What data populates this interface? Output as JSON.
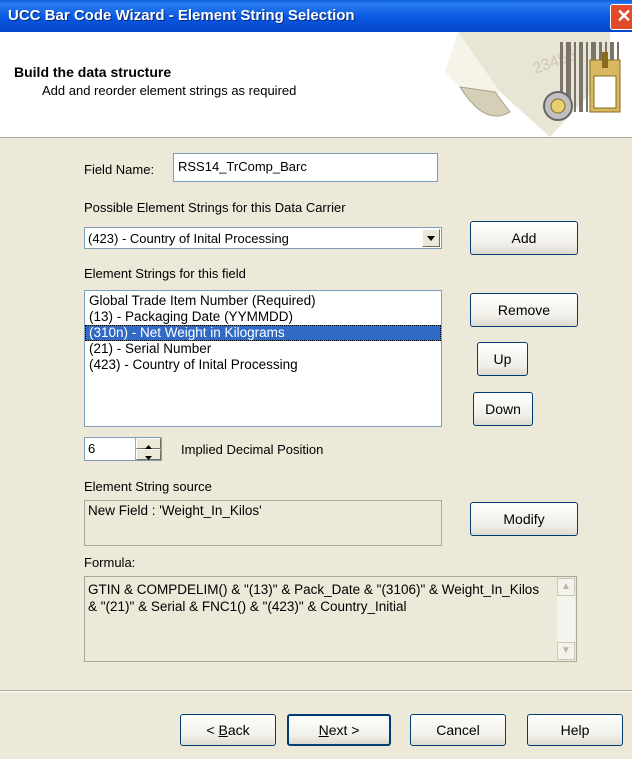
{
  "window": {
    "title": "UCC Bar Code Wizard - Element String Selection",
    "close_glyph": "✕"
  },
  "header": {
    "title": "Build the data structure",
    "subtitle": "Add and reorder element strings as required",
    "art_text": "23456"
  },
  "field_name": {
    "label": "Field Name:",
    "value": "RSS14_TrComp_Barc"
  },
  "possible": {
    "label": "Possible Element Strings for this Data Carrier",
    "selected": "(423) - Country of Inital Processing",
    "add_label": "Add"
  },
  "element_strings": {
    "label": "Element Strings for this field",
    "items": [
      "Global Trade Item Number (Required)",
      "(13) - Packaging Date (YYMMDD)",
      "(310n) - Net Weight in Kilograms",
      "(21) - Serial Number",
      "(423) - Country of Inital Processing"
    ],
    "selected_index": 2,
    "remove_label": "Remove",
    "up_label": "Up",
    "down_label": "Down"
  },
  "decimal": {
    "value": "6",
    "label": "Implied Decimal Position"
  },
  "source": {
    "label": "Element String source",
    "value": "New Field : 'Weight_In_Kilos'",
    "modify_label": "Modify"
  },
  "formula": {
    "label": "Formula:",
    "text": "GTIN & COMPDELIM() & \"(13)\" & Pack_Date & \"(3106)\" & Weight_In_Kilos & \"(21)\" & Serial & FNC1() & \"(423)\" & Country_Initial"
  },
  "footer": {
    "back_rest": "ack",
    "back_mnemonic": "B",
    "back_prefix": "< ",
    "next_mnemonic": "N",
    "next_rest": "ext >",
    "cancel_label": "Cancel",
    "help_label": "Help"
  }
}
